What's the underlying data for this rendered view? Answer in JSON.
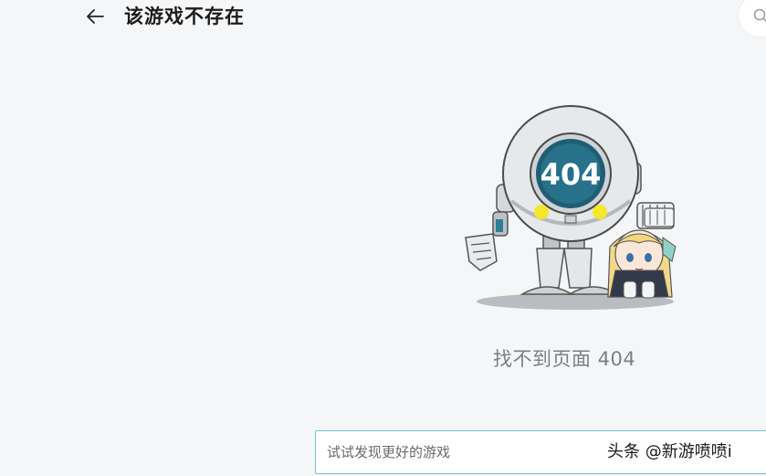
{
  "header": {
    "title": "该游戏不存在",
    "back_icon": "arrow-left-icon",
    "search_icon": "search-icon"
  },
  "illustration": {
    "robot_screen_text": "404",
    "accent_color": "#f5e72a",
    "screen_color": "#1f5d75"
  },
  "main": {
    "not_found_message": "找不到页面 404"
  },
  "search": {
    "placeholder": "试试发现更好的游戏",
    "value": ""
  },
  "watermark": {
    "text": "头条 @新游喷喷i"
  },
  "colors": {
    "background": "#f5f6f8",
    "search_border": "#6ec3cf",
    "message_text": "#7b7f86"
  }
}
